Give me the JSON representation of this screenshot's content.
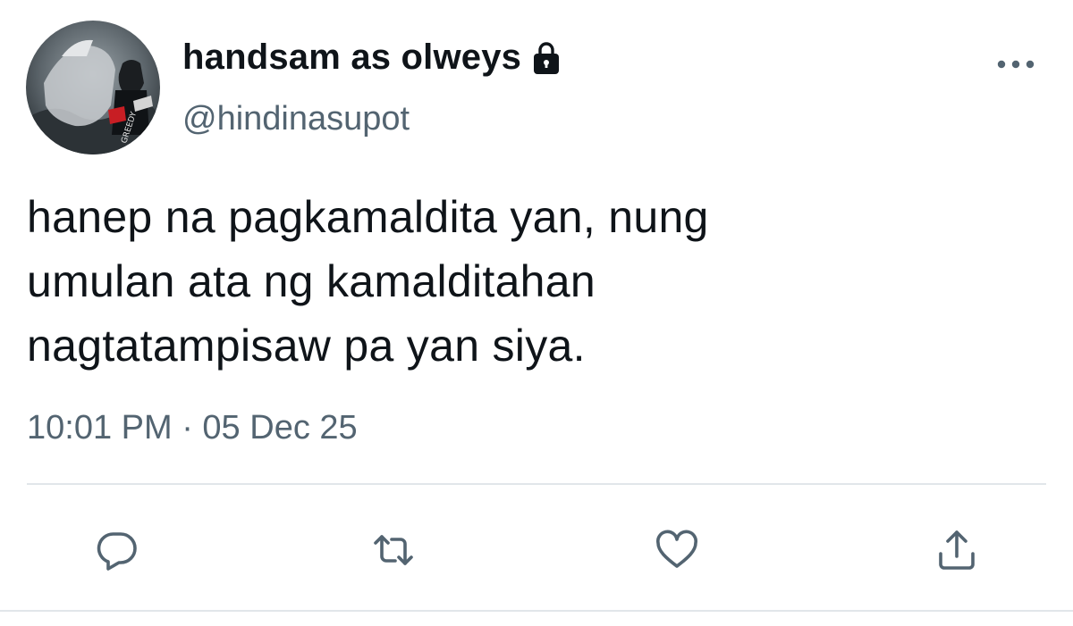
{
  "user": {
    "display_name": "handsam as olweys",
    "handle": "@hindinasupot",
    "avatar_text": "GREEDY"
  },
  "tweet": {
    "text_lines": [
      "hanep na pagkamaldita yan, nung",
      "umulan ata ng kamalditahan",
      "nagtatampisaw pa yan siya."
    ],
    "timestamp": "10:01 PM · 05 Dec 25"
  },
  "icons": {
    "protected": "lock-icon",
    "menu": "more-horizontal-icon",
    "reply": "reply-icon",
    "retweet": "retweet-icon",
    "like": "heart-icon",
    "share": "share-icon"
  },
  "colors": {
    "text": "#0f1419",
    "secondary": "#536471",
    "icon": "#536471",
    "divider": "#e1e6ea"
  }
}
